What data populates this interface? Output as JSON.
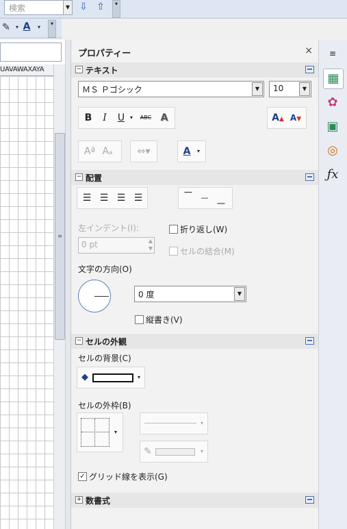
{
  "toolbar": {
    "search_placeholder": "検索",
    "find_next_icon": "arrow-down-icon",
    "find_prev_icon": "arrow-up-icon"
  },
  "sheet": {
    "column_header_text": "UAVAWAXAYA"
  },
  "panel": {
    "title": "プロパティー",
    "close": "×",
    "text_section": {
      "label": "テキスト",
      "font_name": "ＭＳ Ｐゴシック",
      "font_size": "10"
    },
    "align_section": {
      "label": "配置",
      "left_indent_label": "左インデント(I):",
      "left_indent_value": "0 pt",
      "wrap_label": "折り返し(W)",
      "merge_label": "セルの結合(M)",
      "text_direction_label": "文字の方向(O)",
      "rotation_value": "0 度",
      "vertical_label": "縦書き(V)"
    },
    "cell_appearance_section": {
      "label": "セルの外観",
      "background_label": "セルの背景(C)",
      "border_label": "セルの外枠(B)",
      "gridlines_label": "グリッド線を表示(G)",
      "gridlines_checked": true
    },
    "number_format_section": {
      "label": "数書式"
    }
  },
  "colors": {
    "toolbar_bg": "#dde6f2",
    "accent_blue": "#2a5caa"
  }
}
